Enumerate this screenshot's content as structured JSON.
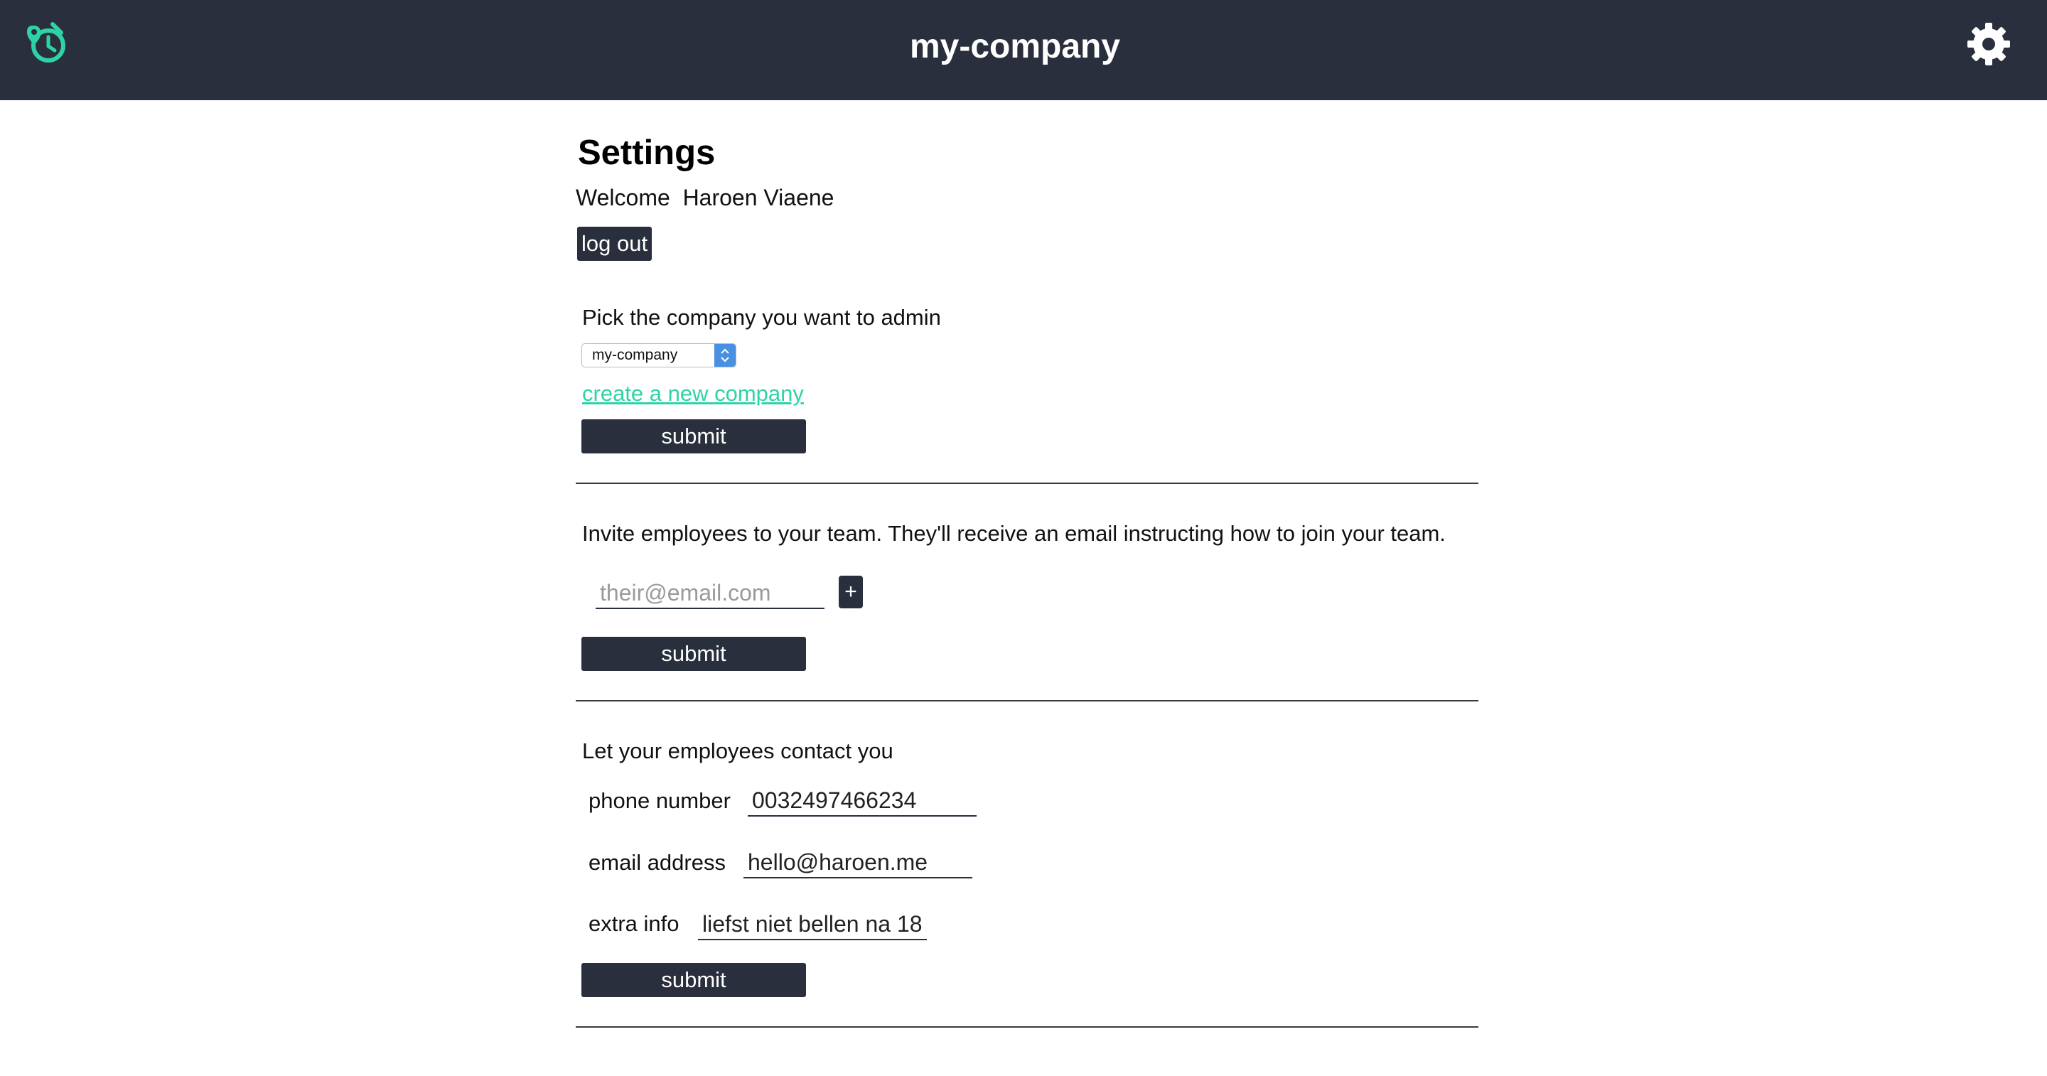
{
  "header": {
    "app_title": "my-company",
    "logo_icon": "alarm-location-logo-icon",
    "settings_icon": "gear-icon",
    "accent_color": "#2ed3a5",
    "bar_color": "#2a2f3d"
  },
  "settings": {
    "title": "Settings",
    "welcome_label": "Welcome",
    "user_name": "Haroen Viaene",
    "logout_label": "log out"
  },
  "company_section": {
    "prompt": "Pick the company you want to admin",
    "selected_company": "my-company",
    "create_link": "create a new company",
    "submit_label": "submit"
  },
  "invite_section": {
    "prompt": "Invite employees to your team. They'll receive an email instructing how to join your team.",
    "email_placeholder": "their@email.com",
    "add_label": "+",
    "submit_label": "submit"
  },
  "contact_section": {
    "prompt": "Let your employees contact you",
    "phone_label": "phone number",
    "phone_value": "0032497466234",
    "email_label": "email address",
    "email_value": "hello@haroen.me",
    "extra_label": "extra info",
    "extra_value": "liefst niet bellen na 18",
    "submit_label": "submit"
  }
}
